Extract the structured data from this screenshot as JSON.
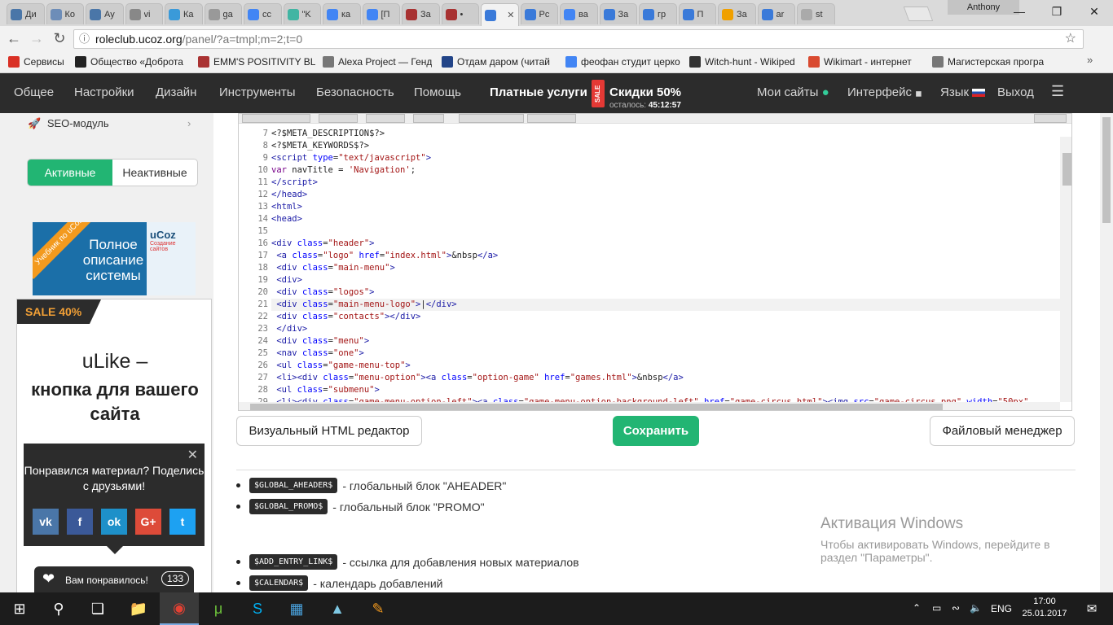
{
  "browser": {
    "tabs": [
      {
        "label": "Ди",
        "color": "#4a76a8"
      },
      {
        "label": "Ко",
        "color": "#6d8db8"
      },
      {
        "label": "Ау",
        "color": "#4a76a8"
      },
      {
        "label": "vi",
        "color": "#888888"
      },
      {
        "label": "Ка",
        "color": "#3a9ad9"
      },
      {
        "label": "ga",
        "color": "#999999"
      },
      {
        "label": "cc",
        "color": "#4285f4"
      },
      {
        "label": "\"K",
        "color": "#41b5a3"
      },
      {
        "label": "ка",
        "color": "#4285f4"
      },
      {
        "label": "[П",
        "color": "#4285f4"
      },
      {
        "label": "За",
        "color": "#a83232"
      },
      {
        "label": "•",
        "color": "#a83232"
      },
      {
        "label": "",
        "color": "#3a7ad9"
      },
      {
        "label": "Рс",
        "color": "#3a7ad9"
      },
      {
        "label": "ва",
        "color": "#4285f4"
      },
      {
        "label": "За",
        "color": "#3a7ad9"
      },
      {
        "label": "гр",
        "color": "#3a7ad9"
      },
      {
        "label": "П",
        "color": "#3a7ad9"
      },
      {
        "label": "За",
        "color": "#f0a000"
      },
      {
        "label": "ar",
        "color": "#3a7ad9"
      },
      {
        "label": "st",
        "color": "#aaaaaa"
      }
    ],
    "user": "Anthony",
    "url_host": "roleclub.ucoz.org",
    "url_path": "/panel/?a=tmpl;m=2;t=0",
    "bookmarks": [
      {
        "label": "Сервисы",
        "color": "#d93025"
      },
      {
        "label": "Общество «Доброта",
        "color": "#222222"
      },
      {
        "label": "EMM'S POSITIVITY BL",
        "color": "#aa3333"
      },
      {
        "label": "Alexa Project — Генд",
        "color": "#777777"
      },
      {
        "label": "Отдам даром (читай",
        "color": "#224488"
      },
      {
        "label": "феофан студит церко",
        "color": "#4285f4"
      },
      {
        "label": "Witch-hunt - Wikiped",
        "color": "#333333"
      },
      {
        "label": "Wikimart - интернет",
        "color": "#d94a30"
      },
      {
        "label": "Магистерская програ",
        "color": "#777777"
      }
    ]
  },
  "topnav": {
    "items": [
      "Общее",
      "Настройки",
      "Дизайн",
      "Инструменты",
      "Безопасность",
      "Помощь"
    ],
    "paid": "Платные услуги",
    "sale_badge": "SALE",
    "discount": "Скидки 50%",
    "timer_label": "осталось:",
    "timer_value": "45:12:57",
    "my_sites": "Мои сайты",
    "interface": "Интерфейс",
    "language": "Язык",
    "logout": "Выход"
  },
  "sidebar": {
    "seo": "SEO-модуль",
    "toggle_active": "Активные",
    "toggle_inactive": "Неактивные",
    "banner_ribbon": "Учебник по uCoz",
    "banner_text": "Полное описание системы",
    "banner_logo": "uCoz",
    "banner_logo_sub": "Создание сайтов",
    "promo_tag": "SALE 40%",
    "promo_title": "uLike –",
    "promo_subtitle": "кнопка для вашего сайта",
    "share_text": "Понравился материал? Поделись с друзьями!",
    "social": [
      {
        "label": "vk",
        "color": "#4a76a8"
      },
      {
        "label": "f",
        "color": "#3b5998"
      },
      {
        "label": "ok",
        "color": "#1e90c9"
      },
      {
        "label": "G+",
        "color": "#dd4b39"
      },
      {
        "label": "t",
        "color": "#1da1f2"
      }
    ],
    "like_label": "Вам понравилось!",
    "like_count": "133"
  },
  "editor": {
    "lines": [
      {
        "n": "7",
        "html": "&lt;?$META_DESCRIPTION$?&gt;"
      },
      {
        "n": "8",
        "html": "&lt;?$META_KEYWORDS$?&gt;"
      },
      {
        "n": "9",
        "html": "<span class='t'>&lt;script</span> <span class='a'>type</span>=<span class='s'>\"text/javascript\"</span><span class='t'>&gt;</span>"
      },
      {
        "n": "10",
        "html": "<span class='k'>var</span> navTitle = <span class='s'>'Navigation'</span>;"
      },
      {
        "n": "11",
        "html": "<span class='t'>&lt;/script&gt;</span>"
      },
      {
        "n": "12",
        "html": "<span class='t'>&lt;/head&gt;</span>"
      },
      {
        "n": "13",
        "html": "<span class='t'>&lt;html&gt;</span>"
      },
      {
        "n": "14",
        "html": "<span class='t'>&lt;head&gt;</span>"
      },
      {
        "n": "15",
        "html": ""
      },
      {
        "n": "16",
        "html": "<span class='t'>&lt;div</span> <span class='a'>class</span>=<span class='s'>\"header\"</span><span class='t'>&gt;</span>"
      },
      {
        "n": "17",
        "html": " <span class='t'>&lt;a</span> <span class='a'>class</span>=<span class='s'>\"logo\"</span> <span class='a'>href</span>=<span class='s'>\"index.html\"</span><span class='t'>&gt;</span>&amp;nbsp<span class='t'>&lt;/a&gt;</span>"
      },
      {
        "n": "18",
        "html": " <span class='t'>&lt;div</span> <span class='a'>class</span>=<span class='s'>\"main-menu\"</span><span class='t'>&gt;</span>"
      },
      {
        "n": "19",
        "html": " <span class='t'>&lt;div&gt;</span>"
      },
      {
        "n": "20",
        "html": " <span class='t'>&lt;div</span> <span class='a'>class</span>=<span class='s'>\"logos\"</span><span class='t'>&gt;</span>"
      },
      {
        "n": "21",
        "html": " <span class='t'>&lt;div</span> <span class='a'>class</span>=<span class='s'>\"main-menu-logo\"</span><span class='t'>&gt;</span>|<span class='t'>&lt;/div&gt;</span>"
      },
      {
        "n": "22",
        "html": " <span class='t'>&lt;div</span> <span class='a'>class</span>=<span class='s'>\"contacts\"</span><span class='t'>&gt;&lt;/div&gt;</span>"
      },
      {
        "n": "23",
        "html": " <span class='t'>&lt;/div&gt;</span>"
      },
      {
        "n": "24",
        "html": " <span class='t'>&lt;div</span> <span class='a'>class</span>=<span class='s'>\"menu\"</span><span class='t'>&gt;</span>"
      },
      {
        "n": "25",
        "html": " <span class='t'>&lt;nav</span> <span class='a'>class</span>=<span class='s'>\"one\"</span><span class='t'>&gt;</span>"
      },
      {
        "n": "26",
        "html": " <span class='t'>&lt;ul</span> <span class='a'>class</span>=<span class='s'>\"game-menu-top\"</span><span class='t'>&gt;</span>"
      },
      {
        "n": "27",
        "html": " <span class='t'>&lt;li&gt;&lt;div</span> <span class='a'>class</span>=<span class='s'>\"menu-option\"</span><span class='t'>&gt;&lt;a</span> <span class='a'>class</span>=<span class='s'>\"option-game\"</span> <span class='a'>href</span>=<span class='s'>\"games.html\"</span><span class='t'>&gt;</span>&amp;nbsp<span class='t'>&lt;/a&gt;</span>"
      },
      {
        "n": "28",
        "html": " <span class='t'>&lt;ul</span> <span class='a'>class</span>=<span class='s'>\"submenu\"</span><span class='t'>&gt;</span>"
      },
      {
        "n": "29",
        "html": " <span class='t'>&lt;li&gt;&lt;div</span> <span class='a'>class</span>=<span class='s'>\"game-menu-option-left\"</span><span class='t'>&gt;&lt;a</span> <span class='a'>class</span>=<span class='s'>\"game-menu-option-background-left\"</span> <span class='a'>href</span>=<span class='s'>\"game-circus.html\"</span><span class='t'>&gt;&lt;img</span> <span class='a'>src</span>=<span class='s'>\"game-circus.png\"</span> <span class='a'>width</span>=<span class='s'>\"50px\"</span>"
      }
    ],
    "highlighted_line": "21",
    "btn_visual": "Визуальный HTML редактор",
    "btn_save": "Сохранить",
    "btn_files": "Файловый менеджер"
  },
  "variables": [
    {
      "code": "$GLOBAL_AHEADER$",
      "desc": "- глобальный блок \"AHEADER\""
    },
    {
      "code": "$GLOBAL_PROMO$",
      "desc": "- глобальный блок \"PROMO\""
    },
    {
      "code": "$ADD_ENTRY_LINK$",
      "desc": "- ссылка для добавления новых материалов"
    },
    {
      "code": "$CALENDAR$",
      "desc": "- календарь добавлений"
    }
  ],
  "activation": {
    "title": "Активация Windows",
    "text1": "Чтобы активировать Windows, перейдите в",
    "text2": "раздел \"Параметры\"."
  },
  "taskbar": {
    "lang": "ENG",
    "time": "17:00",
    "date": "25.01.2017"
  }
}
